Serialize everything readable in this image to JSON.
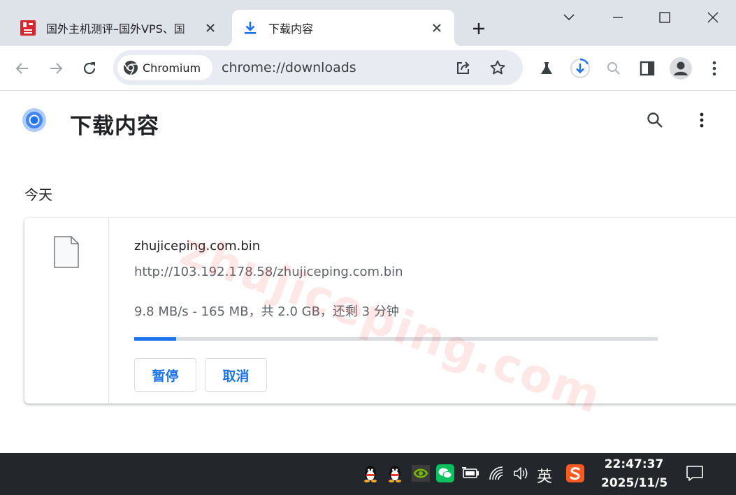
{
  "tabs": [
    {
      "title": "国外主机测评–国外VPS、国"
    },
    {
      "title": "下载内容"
    }
  ],
  "toolbar": {
    "chip_label": "Chromium",
    "url": "chrome://downloads"
  },
  "page": {
    "title": "下载内容",
    "section_date": "今天"
  },
  "download": {
    "file_name": "zhujiceping.com.bin",
    "url": "http://103.192.178.58/zhujiceping.com.bin",
    "status": "9.8 MB/s - 165 MB，共 2.0 GB，还剩 3 分钟",
    "progress": 0.08,
    "pause_label": "暂停",
    "cancel_label": "取消"
  },
  "watermark": "zhujiceping.com",
  "taskbar": {
    "ime": "英",
    "time": "22:47:37",
    "date": "2025/11/5"
  },
  "colors": {
    "accent": "#1a73e8",
    "tabstrip": "#dee3ea",
    "taskbar": "#23272b"
  }
}
